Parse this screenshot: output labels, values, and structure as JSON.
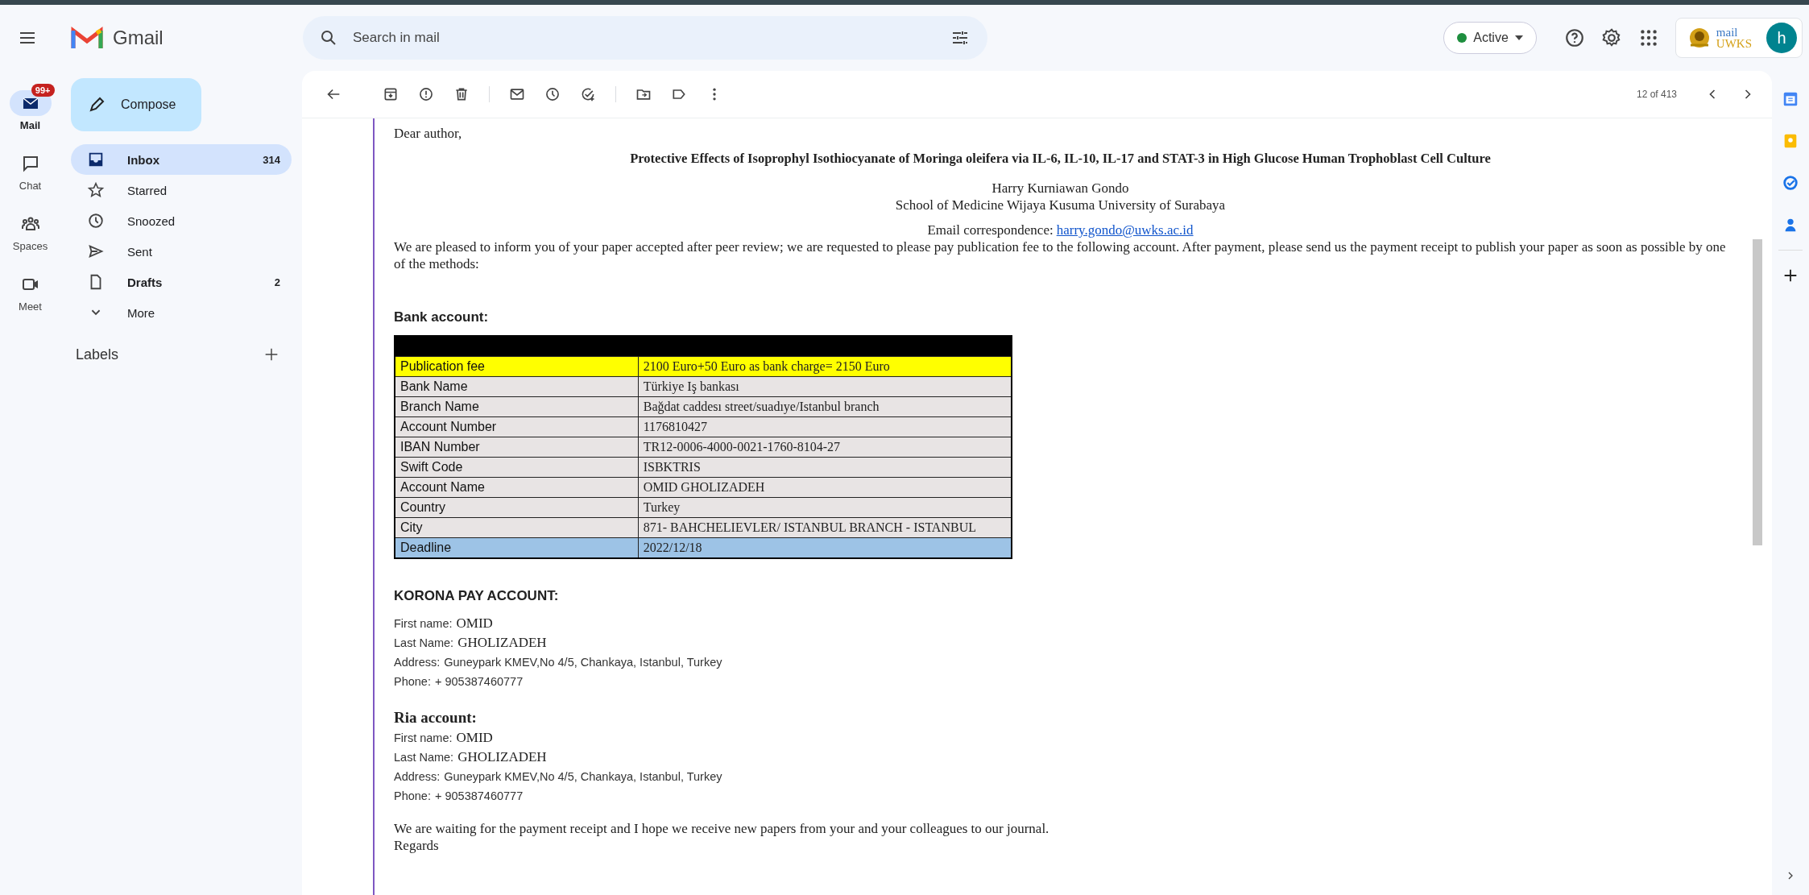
{
  "header": {
    "product": "Gmail",
    "search": {
      "placeholder": "Search in mail"
    },
    "status": {
      "label": "Active",
      "color": "#1e8e3e"
    },
    "org_logo": {
      "line_1": "mail",
      "line_2": "UWKS"
    },
    "avatar": "h"
  },
  "rail": [
    {
      "kind": "mail",
      "label": "Mail",
      "selected": true,
      "badge": "99+"
    },
    {
      "kind": "chat",
      "label": "Chat",
      "selected": false
    },
    {
      "kind": "spaces",
      "label": "Spaces",
      "selected": false
    },
    {
      "kind": "meet",
      "label": "Meet",
      "selected": false
    }
  ],
  "compose": "Compose",
  "folders": [
    {
      "kind": "inbox",
      "label": "Inbox",
      "count": "314",
      "selected": true,
      "unread": true
    },
    {
      "kind": "starred",
      "label": "Starred",
      "selected": false,
      "unread": false
    },
    {
      "kind": "snoozed",
      "label": "Snoozed",
      "selected": false,
      "unread": false
    },
    {
      "kind": "sent",
      "label": "Sent",
      "selected": false,
      "unread": false
    },
    {
      "kind": "drafts",
      "label": "Drafts",
      "count": "2",
      "selected": false,
      "unread": true
    },
    {
      "kind": "more",
      "label": "More",
      "selected": false,
      "unread": false
    }
  ],
  "labels": {
    "title": "Labels"
  },
  "toolbar": {
    "position": "12 of 413"
  },
  "message": {
    "greeting": "Dear author,",
    "title": "Protective Effects of Isoprophyl Isothiocyanate of Moringa oleifera via IL-6, IL-10, IL-17 and STAT-3 in High Glucose Human Trophoblast Cell Culture",
    "author": "Harry Kurniawan Gondo",
    "affiliation": "School of Medicine Wijaya Kusuma University of Surabaya",
    "correspondence": {
      "label": "Email correspondence:",
      "link": "harry.gondo@uwks.ac.id"
    },
    "body": "We are pleased to inform you of your paper accepted after peer review; we are requested to please pay publication fee to the following account. After payment, please send us the payment receipt to publish your paper as soon as possible  by one of the methods:",
    "bank_heading": "Bank account:",
    "bank_table": {
      "rows": [
        {
          "label": "Publication fee",
          "value": "2100 Euro+50  Euro as bank charge= 2150 Euro",
          "color": "#ffff00"
        },
        {
          "label": "Bank Name",
          "value": "Türkiye Iş bankası",
          "color": "#e8e4e4"
        },
        {
          "label": "Branch Name",
          "value": "Bağdat caddesı street/suadıye/Istanbul branch",
          "color": "#e8e4e4"
        },
        {
          "label": "Account Number",
          "value": "1176810427",
          "color": "#e8e4e4"
        },
        {
          "label": "IBAN Number",
          "value": "TR12-0006-4000-0021-1760-8104-27",
          "color": "#e8e4e4"
        },
        {
          "label": "Swift Code",
          "value": "ISBKTRIS",
          "color": "#e8e4e4"
        },
        {
          "label": "Account Name",
          "value": "OMID GHOLIZADEH",
          "color": "#e8e4e4"
        },
        {
          "label": "Country",
          "value": "Turkey",
          "color": "#e8e4e4"
        },
        {
          "label": "City",
          "value": "871- BAHCHELIEVLER/ ISTANBUL BRANCH - ISTANBUL",
          "color": "#e8e4e4"
        },
        {
          "label": "Deadline",
          "value": "2022/12/18",
          "color": "#9dc3e6"
        }
      ]
    },
    "sections": [
      {
        "kind": "sans",
        "heading": "KORONA PAY ACCOUNT:",
        "lines": [
          {
            "kind": "name",
            "label": "First name:",
            "value": "OMID"
          },
          {
            "kind": "name",
            "label": "Last Name:",
            "value": "GHOLIZADEH"
          },
          {
            "kind": "plain",
            "label": "Address:",
            "value": "Guneypark KMEV,No 4/5, Chankaya, Istanbul, Turkey"
          },
          {
            "kind": "plain",
            "label": "Phone:",
            "value": "+ 905387460777"
          }
        ]
      },
      {
        "kind": "serif",
        "heading": "Ria account:",
        "lines": [
          {
            "kind": "name",
            "label": "First name:",
            "value": "OMID"
          },
          {
            "kind": "name",
            "label": "Last Name:",
            "value": "GHOLIZADEH"
          },
          {
            "kind": "plain",
            "label": "Address:",
            "value": "Guneypark KMEV,No 4/5, Chankaya, Istanbul, Turkey"
          },
          {
            "kind": "plain",
            "label": "Phone:",
            "value": "+ 905387460777"
          }
        ]
      }
    ],
    "closing": "We are waiting for the payment receipt and I hope we receive new papers from your and your colleagues to our journal.",
    "sign_off": "Regards"
  }
}
